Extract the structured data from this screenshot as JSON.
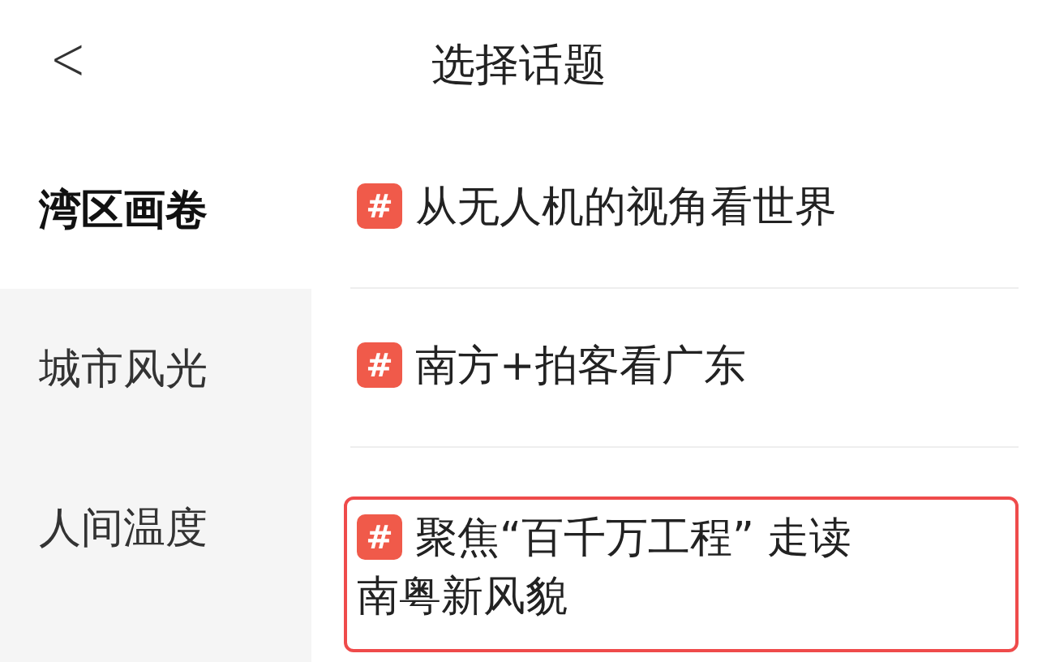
{
  "header": {
    "back": "<",
    "title": "选择话题"
  },
  "categories": [
    {
      "label": "湾区画卷",
      "selected": true
    },
    {
      "label": "城市风光",
      "selected": false
    },
    {
      "label": "人间温度",
      "selected": false
    }
  ],
  "topics": [
    {
      "badge": "#",
      "text": "从无人机的视角看世界",
      "highlighted": false
    },
    {
      "badge": "#",
      "text": "南方+拍客看广东",
      "highlighted": false
    },
    {
      "badge": "#",
      "text": "聚焦“百千万工程” 走读南粤新风貌",
      "highlighted": true
    }
  ]
}
